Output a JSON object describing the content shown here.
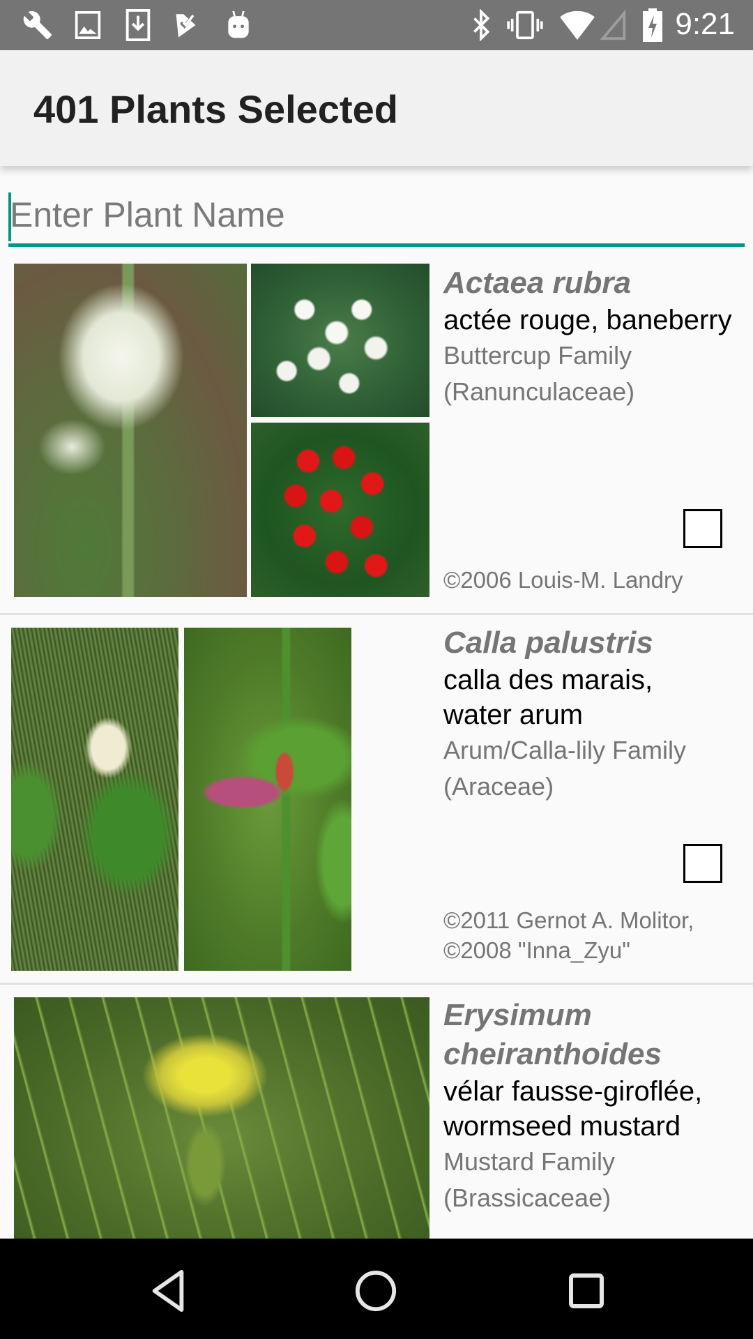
{
  "status_bar": {
    "left_icons": [
      "wrench-icon",
      "image-icon",
      "download-icon",
      "checklist-icon",
      "android-icon"
    ],
    "right_icons": [
      "bluetooth-icon",
      "vibrate-icon",
      "wifi-icon",
      "cell-signal-icon",
      "battery-charging-icon"
    ],
    "time": "9:21"
  },
  "app_bar": {
    "title": "401 Plants Selected"
  },
  "search": {
    "placeholder": "Enter Plant Name",
    "value": ""
  },
  "plants": [
    {
      "scientific_name": "Actaea rubra",
      "common_name": "actée rouge, baneberry",
      "family": "Buttercup Family (Ranunculaceae)",
      "credit": "©2006 Louis-M. Landry",
      "selected": false,
      "photos": [
        "white flower cluster",
        "white berries",
        "red berries"
      ]
    },
    {
      "scientific_name": "Calla palustris",
      "common_name": "calla des marais, water arum",
      "family": "Arum/Calla-lily Family (Araceae)",
      "credit": "©2011 Gernot A. Molitor, ©2008 \"Inna_Zyu\"",
      "selected": false,
      "photos": [
        "white spathe with green spadix",
        "purple spathe with red fruit"
      ]
    },
    {
      "scientific_name": "Erysimum cheiranthoides",
      "common_name": "vélar fausse-giroflée, wormseed mustard",
      "family": "Mustard Family (Brassicaceae)",
      "credit": "",
      "selected": false,
      "photos": [
        "yellow flower cluster"
      ]
    }
  ],
  "nav_bar": {
    "buttons": [
      "back-icon",
      "home-icon",
      "recents-icon"
    ]
  },
  "colors": {
    "accent": "#009688",
    "status_bar": "#757575",
    "app_bar": "#f1f1f1",
    "secondary_text": "#757575"
  }
}
